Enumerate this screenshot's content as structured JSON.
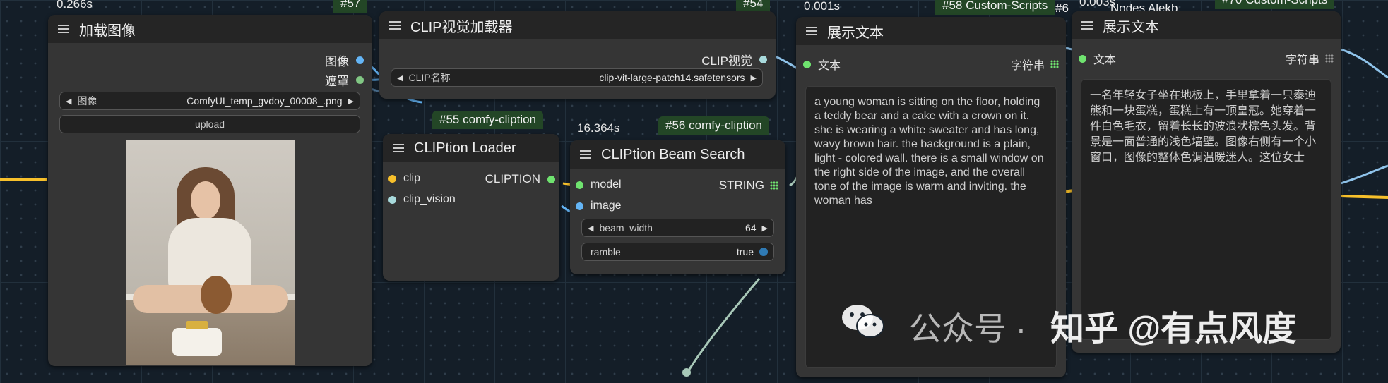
{
  "timings": {
    "load_image": "0.266s",
    "beam_search": "16.364s",
    "show_text_1": "0.001s",
    "show_text_2": "0.003s"
  },
  "badges": {
    "load_image": "#57",
    "clip_vision_loader": "#54",
    "cliption_loader": "#55 comfy-cliption",
    "beam_search": "#56 comfy-cliption",
    "show_text_1": "#58 Custom-Scripts",
    "show_text_1_extra": "#6",
    "show_text_2_left": "Nodes Alekb",
    "show_text_2": "#70 Custom-Scripts"
  },
  "load_image_node": {
    "title": "加载图像",
    "outputs": [
      {
        "label": "图像",
        "color": "#64b5f6"
      },
      {
        "label": "遮罩",
        "color": "#81c784"
      }
    ],
    "image_widget": {
      "label": "图像",
      "value": "ComfyUI_temp_gvdoy_00008_.png"
    },
    "upload_label": "upload"
  },
  "clip_vision_loader_node": {
    "title": "CLIP视觉加载器",
    "output": "CLIP视觉",
    "widget": {
      "label": "CLIP名称",
      "value": "clip-vit-large-patch14.safetensors"
    }
  },
  "cliption_loader_node": {
    "title": "CLIPtion Loader",
    "inputs": [
      {
        "label": "clip",
        "color": "#f7c02b"
      },
      {
        "label": "clip_vision",
        "color": "#a8dadc"
      }
    ],
    "output": "CLIPTION"
  },
  "beam_search_node": {
    "title": "CLIPtion Beam Search",
    "inputs": [
      {
        "label": "model",
        "color": "#6fe36f"
      },
      {
        "label": "image",
        "color": "#64b5f6"
      }
    ],
    "output": "STRING",
    "widgets": [
      {
        "label": "beam_width",
        "value": "64"
      },
      {
        "label": "ramble",
        "value": "true"
      }
    ]
  },
  "show_text_node_1": {
    "title": "展示文本",
    "input": "文本",
    "output": "字符串",
    "text": "a young woman is sitting on the floor, holding a teddy bear and a cake with a crown on it. she is wearing a white sweater and has long, wavy brown hair. the background is a plain, light - colored wall. there is a small window on the right side of the image, and the overall tone of the image is warm and inviting. the woman has"
  },
  "show_text_node_2": {
    "title": "展示文本",
    "input": "文本",
    "output": "字符串",
    "text": "一名年轻女子坐在地板上，手里拿着一只泰迪熊和一块蛋糕，蛋糕上有一顶皇冠。她穿着一件白色毛衣，留着长长的波浪状棕色头发。背景是一面普通的浅色墙壁。图像右侧有一个小窗口，图像的整体色调温暖迷人。这位女士"
  },
  "watermark": {
    "wechat": "公众号 ·",
    "zhihu": "知乎 @有点风度"
  },
  "colors": {
    "node_body": "#353535",
    "node_header": "#252525",
    "badge": "#234626",
    "canvas": "#141e28"
  }
}
